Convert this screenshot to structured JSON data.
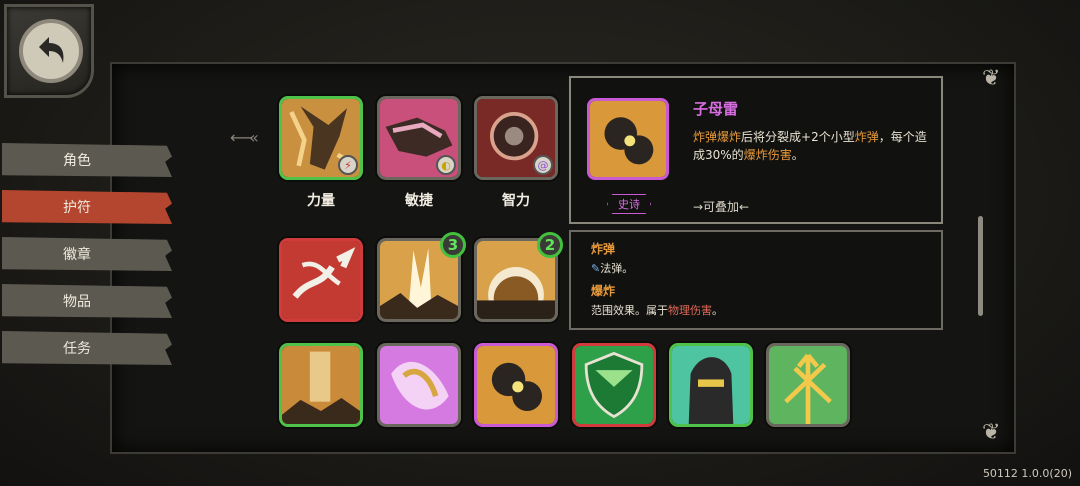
{
  "nav": {
    "back_label": "",
    "tabs": [
      {
        "label": "角色",
        "active": false
      },
      {
        "label": "护符",
        "active": true
      },
      {
        "label": "徽章",
        "active": false
      },
      {
        "label": "物品",
        "active": false
      },
      {
        "label": "任务",
        "active": false
      }
    ]
  },
  "stats": [
    {
      "label": "力量"
    },
    {
      "label": "敏捷"
    },
    {
      "label": "智力"
    }
  ],
  "badges": {
    "row2_icon2": "3",
    "row2_icon3": "2"
  },
  "detail": {
    "name": "子母雷",
    "desc_parts": {
      "p1": "炸弹爆炸",
      "p2": "后将分裂成+2个小型",
      "p3": "炸弹",
      "p4": "，每个造成30%的",
      "p5": "爆炸伤害",
      "p6": "。"
    },
    "rarity": "史诗",
    "stack": "→可叠加←"
  },
  "tips": {
    "term1": "炸弹",
    "term1_desc": "法弹。",
    "term2": "爆炸",
    "term2_desc_a": "范围效果。属于",
    "term2_desc_b": "物理伤害",
    "term2_desc_c": "。"
  },
  "version": "50112 1.0.0(20)",
  "colors": {
    "epic": "#c95ad4",
    "uncommon": "#4fc24a",
    "rare": "#d23b3b",
    "active_tab": "#b4452e",
    "highlight": "#e89a3a"
  }
}
